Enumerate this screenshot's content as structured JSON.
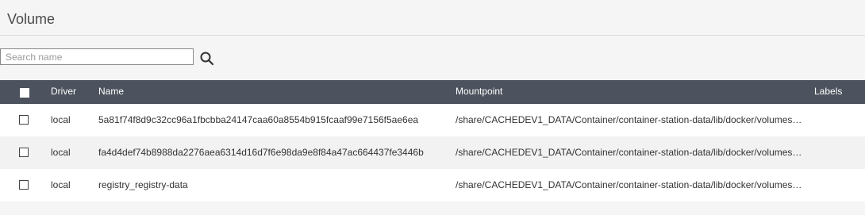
{
  "header": {
    "title": "Volume"
  },
  "search": {
    "placeholder": "Search name",
    "value": ""
  },
  "icons": {
    "search": "search-icon"
  },
  "colors": {
    "table_header_bg": "#4c535e",
    "page_bg": "#f5f5f6"
  },
  "table": {
    "columns": {
      "driver": "Driver",
      "name": "Name",
      "mountpoint": "Mountpoint",
      "labels": "Labels"
    },
    "rows": [
      {
        "driver": "local",
        "name": "5a81f74f8d9c32cc96a1fbcbba24147caa60a8554b915fcaaf99e7156f5ae6ea",
        "mountpoint": "/share/CACHEDEV1_DATA/Container/container-station-data/lib/docker/volumes…",
        "labels": ""
      },
      {
        "driver": "local",
        "name": "fa4d4def74b8988da2276aea6314d16d7f6e98da9e8f84a47ac664437fe3446b",
        "mountpoint": "/share/CACHEDEV1_DATA/Container/container-station-data/lib/docker/volumes…",
        "labels": ""
      },
      {
        "driver": "local",
        "name": "registry_registry-data",
        "mountpoint": "/share/CACHEDEV1_DATA/Container/container-station-data/lib/docker/volumes…",
        "labels": ""
      }
    ]
  }
}
